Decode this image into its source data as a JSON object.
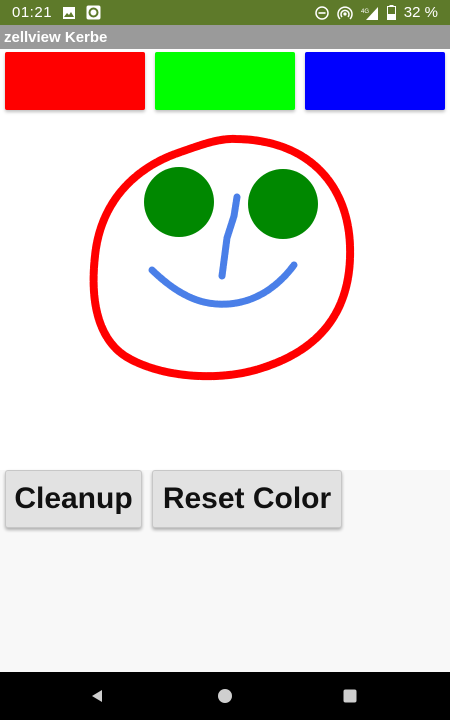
{
  "status_bar": {
    "time": "01:21",
    "battery_percent": "32 %",
    "icons": [
      "image-icon",
      "circle-app-icon",
      "do-not-disturb-icon",
      "hotspot-icon",
      "signal-4g-icon",
      "battery-icon"
    ]
  },
  "app": {
    "title": "zellview Kerbe"
  },
  "palette": {
    "swatches": [
      {
        "name": "red",
        "color": "#ff0000"
      },
      {
        "name": "green",
        "color": "#00ff00"
      },
      {
        "name": "blue",
        "color": "#0000ff"
      }
    ]
  },
  "drawing": {
    "face_outline_color": "#ff0000",
    "eye_color": "#008800",
    "nose_color": "#4a7fe8",
    "mouth_color": "#4a7fe8"
  },
  "buttons": {
    "cleanup_label": "Cleanup",
    "reset_color_label": "Reset Color"
  },
  "nav_bar": {
    "icons": [
      "back-icon",
      "home-icon",
      "recents-icon"
    ]
  }
}
